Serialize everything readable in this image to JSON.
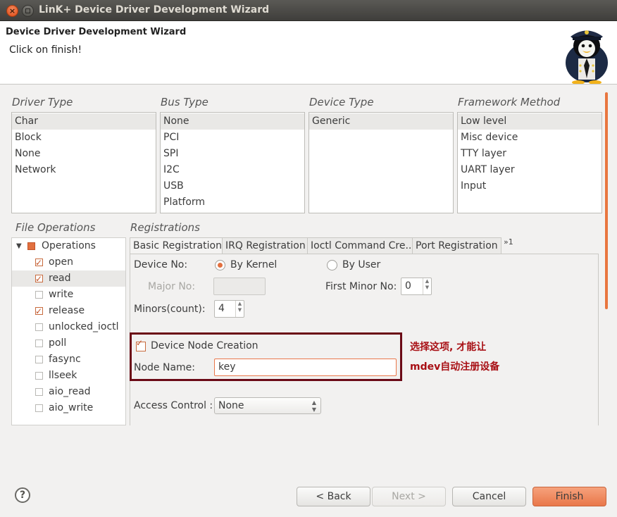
{
  "window": {
    "title": "LinK+ Device Driver Development Wizard"
  },
  "header": {
    "wizard_title": "Device Driver Development Wizard",
    "description": "Click on finish!"
  },
  "groups": {
    "driver_type": {
      "label": "Driver Type",
      "items": [
        "Char",
        "Block",
        "None",
        "Network"
      ],
      "selected": "Char"
    },
    "bus_type": {
      "label": "Bus Type",
      "items": [
        "None",
        "PCI",
        "SPI",
        "I2C",
        "USB",
        "Platform"
      ],
      "selected": "None"
    },
    "device_type": {
      "label": "Device Type",
      "items": [
        "Generic"
      ],
      "selected": "Generic"
    },
    "framework_method": {
      "label": "Framework Method",
      "items": [
        "Low level",
        "Misc device",
        "TTY layer",
        "UART layer",
        "Input"
      ],
      "selected": "Low level"
    }
  },
  "file_operations": {
    "label": "File Operations",
    "root": "Operations",
    "items": [
      {
        "label": "open",
        "checked": true
      },
      {
        "label": "read",
        "checked": true
      },
      {
        "label": "write",
        "checked": false
      },
      {
        "label": "release",
        "checked": true
      },
      {
        "label": "unlocked_ioctl",
        "checked": false
      },
      {
        "label": "poll",
        "checked": false
      },
      {
        "label": "fasync",
        "checked": false
      },
      {
        "label": "llseek",
        "checked": false
      },
      {
        "label": "aio_read",
        "checked": false
      },
      {
        "label": "aio_write",
        "checked": false
      }
    ]
  },
  "registrations": {
    "label": "Registrations",
    "tabs": [
      "Basic Registration",
      "IRQ Registration",
      "Ioctl Command Cre...",
      "Port Registration"
    ],
    "overflow": "»1",
    "device_no_label": "Device No:",
    "by_kernel": "By Kernel",
    "by_user": "By User",
    "major_no_label": "Major No:",
    "major_no_value": "",
    "first_minor_label": "First Minor No:",
    "first_minor_value": "0",
    "minors_label": "Minors(count):",
    "minors_value": "4",
    "device_node_label": "Device Node Creation",
    "node_name_label": "Node Name:",
    "node_name_value": "key",
    "access_control_label": "Access Control :",
    "access_control_value": "None"
  },
  "annotation": {
    "line1": "选择这项, 才能让",
    "line2": "mdev自动注册设备",
    "color": "#a80f14"
  },
  "buttons": {
    "back": "< Back",
    "next": "Next >",
    "cancel": "Cancel",
    "finish": "Finish"
  },
  "accent": "#e9774a"
}
